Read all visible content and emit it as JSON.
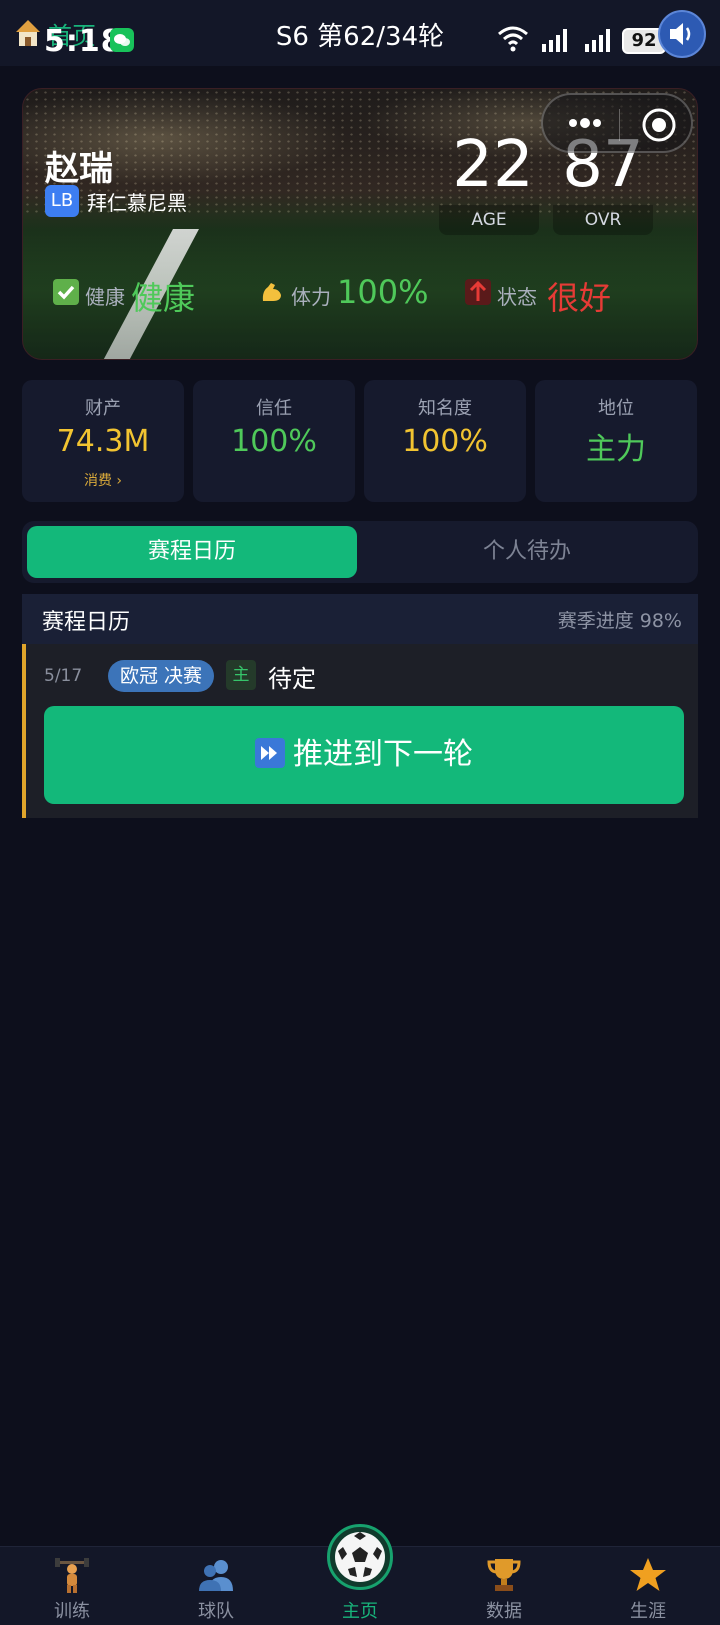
{
  "status_bar": {
    "home_label": "首页",
    "time": "5:18",
    "round_info": "S6 第62/34轮",
    "battery": "92"
  },
  "player": {
    "name": "赵瑞",
    "position": "LB",
    "team": "拜仁慕尼黑",
    "age": "22",
    "age_label": "AGE",
    "ovr": "87",
    "ovr_label": "OVR",
    "health_label": "健康",
    "health_value": "健康",
    "stamina_label": "体力",
    "stamina_value": "100%",
    "form_label": "状态",
    "form_value": "很好"
  },
  "info_cards": [
    {
      "label": "财产",
      "value": "74.3M",
      "link": "消费 ›"
    },
    {
      "label": "信任",
      "value": "100%"
    },
    {
      "label": "知名度",
      "value": "100%"
    },
    {
      "label": "地位",
      "value": "主力"
    }
  ],
  "tabs": [
    {
      "label": "赛程日历",
      "active": true
    },
    {
      "label": "个人待办",
      "active": false
    }
  ],
  "schedule": {
    "title": "赛程日历",
    "season_progress": "赛季进度 98%",
    "match": {
      "date": "5/17",
      "competition": "欧冠 决赛",
      "venue": "主",
      "opponent": "待定"
    },
    "advance_label": "推进到下一轮"
  },
  "bottom_nav": [
    {
      "label": "训练",
      "icon": "weightlifter-icon"
    },
    {
      "label": "球队",
      "icon": "team-icon"
    },
    {
      "label": "主页",
      "icon": "soccer-ball-icon",
      "active": true
    },
    {
      "label": "数据",
      "icon": "trophy-icon"
    },
    {
      "label": "生涯",
      "icon": "star-icon"
    }
  ],
  "colors": {
    "accent": "#13b87a",
    "background": "#0d0f1c",
    "gold": "#f2c431",
    "green_value": "#4fc95a",
    "red_value": "#e63b36"
  }
}
